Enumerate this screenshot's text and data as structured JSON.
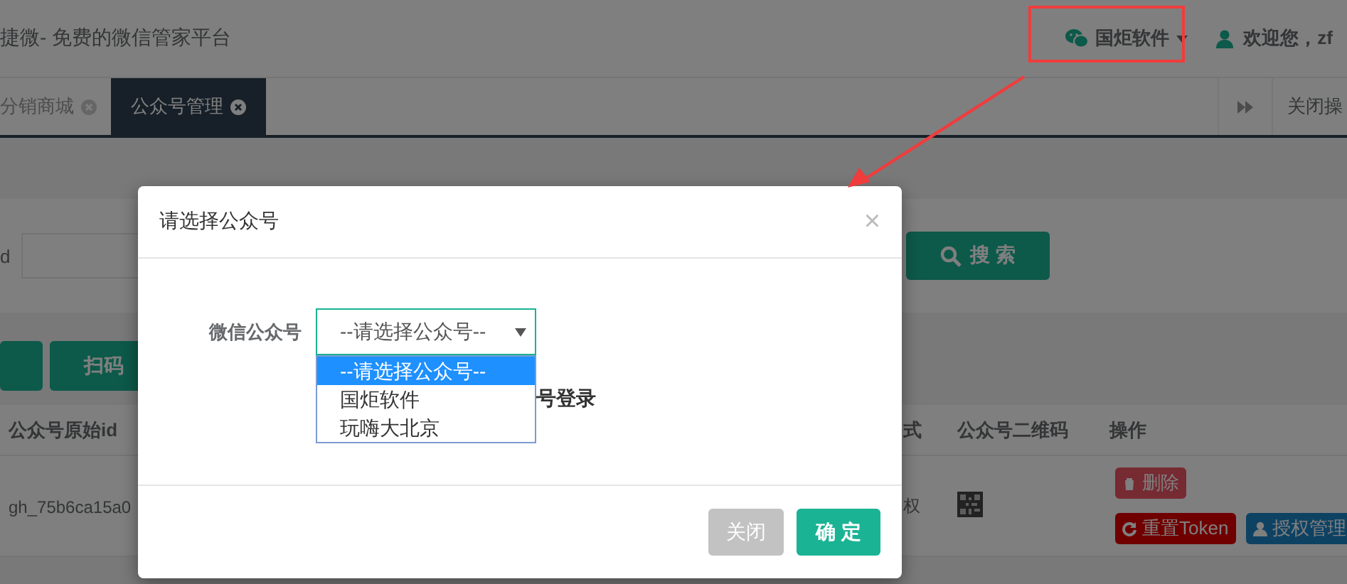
{
  "header": {
    "title": "捷微- 免费的微信管家平台",
    "account": {
      "label": "国炬软件"
    },
    "user": {
      "greeting": "欢迎您，zf"
    }
  },
  "tabs": [
    {
      "label": "分销商城",
      "selected": false
    },
    {
      "label": "公众号管理",
      "selected": true
    }
  ],
  "tab_actions": {
    "close_label": "关闭操"
  },
  "search": {
    "label": "d",
    "button": "搜 索"
  },
  "toolbar": {
    "buttons": [
      "扫码"
    ]
  },
  "table": {
    "columns": [
      "公众号原始id",
      "式",
      "公众号二维码",
      "操作"
    ],
    "rows": [
      {
        "cells": [
          "gh_75b6ca15a0",
          "权"
        ],
        "actions": [
          {
            "kind": "delete",
            "label": "删除"
          },
          {
            "kind": "reset",
            "label": "重置Token"
          },
          {
            "kind": "admin",
            "label": "授权管理"
          }
        ]
      }
    ]
  },
  "modal": {
    "title": "请选择公众号",
    "close": "×",
    "field_label": "微信公众号",
    "select": {
      "value": "--请选择公众号--",
      "expanded": true,
      "options": [
        {
          "label": "--请选择公众号--",
          "selected": true
        },
        {
          "label": "国炬软件",
          "selected": false
        },
        {
          "label": "玩嗨大北京",
          "selected": false
        }
      ]
    },
    "hidden_text": "号登录",
    "buttons": [
      {
        "kind": "cancel",
        "label": "关闭"
      },
      {
        "kind": "primary",
        "label": "确 定"
      }
    ]
  }
}
